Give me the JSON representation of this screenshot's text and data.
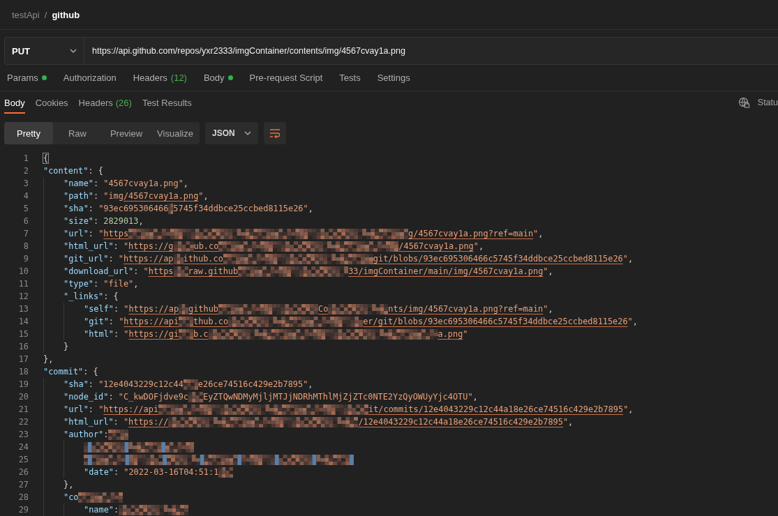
{
  "breadcrumb": {
    "parent": "testApi",
    "separator": "/",
    "current": "github"
  },
  "request": {
    "method": "PUT",
    "url": "https://api.github.com/repos/yxr2333/imgContainer/contents/img/4567cvay1a.png"
  },
  "request_tabs": [
    {
      "label": "Params",
      "indicator": true
    },
    {
      "label": "Authorization",
      "indicator": false
    },
    {
      "label": "Headers",
      "count": "(12)",
      "indicator": false
    },
    {
      "label": "Body",
      "indicator": true
    },
    {
      "label": "Pre-request Script",
      "indicator": false
    },
    {
      "label": "Tests",
      "indicator": false
    },
    {
      "label": "Settings",
      "indicator": false
    }
  ],
  "response_tabs": [
    {
      "label": "Body",
      "selected": true
    },
    {
      "label": "Cookies",
      "selected": false
    },
    {
      "label": "Headers",
      "count": "(26)",
      "selected": false
    },
    {
      "label": "Test Results",
      "selected": false
    }
  ],
  "response_status": "Statu",
  "view_modes": [
    {
      "label": "Pretty",
      "selected": true
    },
    {
      "label": "Raw",
      "selected": false
    },
    {
      "label": "Preview",
      "selected": false
    },
    {
      "label": "Visualize",
      "selected": false
    }
  ],
  "format": "JSON",
  "code_lines": [
    {
      "num": "1",
      "segments": [
        {
          "kind": "bracket_match",
          "text": "{"
        }
      ]
    },
    {
      "num": "2",
      "segments": [
        {
          "kind": "key",
          "text": "\"content\""
        },
        {
          "kind": "punct",
          "text": ": {"
        }
      ],
      "children": [
        {
          "num": "3",
          "segments": [
            {
              "kind": "key",
              "text": "\"name\""
            },
            {
              "kind": "punct",
              "text": ": "
            },
            {
              "kind": "string",
              "text": "\"4567cvay1a.png\""
            },
            {
              "kind": "punct",
              "text": ","
            }
          ]
        },
        {
          "num": "4",
          "segments": [
            {
              "kind": "key",
              "text": "\"path\""
            },
            {
              "kind": "punct",
              "text": ": "
            },
            {
              "kind": "string",
              "text": "\"img"
            },
            {
              "kind": "link",
              "text": "/4567cvay1a.png"
            },
            {
              "kind": "string",
              "text": "\""
            },
            {
              "kind": "punct",
              "text": ","
            }
          ]
        },
        {
          "num": "5",
          "segments": [
            {
              "kind": "key",
              "text": "\"sha\""
            },
            {
              "kind": "punct",
              "text": ": "
            },
            {
              "kind": "string",
              "text": "\"93ec695306466"
            },
            {
              "kind": "redacted"
            },
            {
              "kind": "string",
              "text": "5745f34ddbce25ccbed8115e26\""
            },
            {
              "kind": "punct",
              "text": ","
            }
          ]
        },
        {
          "num": "6",
          "segments": [
            {
              "kind": "key",
              "text": "\"size\""
            },
            {
              "kind": "punct",
              "text": ": "
            },
            {
              "kind": "number",
              "text": "2829013"
            },
            {
              "kind": "punct",
              "text": ","
            }
          ]
        },
        {
          "num": "7",
          "segments": [
            {
              "kind": "key",
              "text": "\"url\""
            },
            {
              "kind": "punct",
              "text": ": "
            },
            {
              "kind": "string",
              "text": "\""
            },
            {
              "kind": "link",
              "text": "https"
            },
            {
              "kind": "redacted"
            },
            {
              "kind": "link",
              "text": "g/4567cvay1a.png?ref=main"
            },
            {
              "kind": "string",
              "text": "\""
            },
            {
              "kind": "punct",
              "text": ","
            }
          ]
        },
        {
          "num": "8",
          "segments": [
            {
              "kind": "key",
              "text": "\"html_url\""
            },
            {
              "kind": "punct",
              "text": ": "
            },
            {
              "kind": "string",
              "text": "\""
            },
            {
              "kind": "link",
              "text": "https://g"
            },
            {
              "kind": "redacted"
            },
            {
              "kind": "link",
              "text": "ub.co"
            },
            {
              "kind": "redacted"
            },
            {
              "kind": "link",
              "text": "/4567cvay1a.png"
            },
            {
              "kind": "string",
              "text": "\""
            },
            {
              "kind": "punct",
              "text": ","
            }
          ]
        },
        {
          "num": "9",
          "segments": [
            {
              "kind": "key",
              "text": "\"git_url\""
            },
            {
              "kind": "punct",
              "text": ": "
            },
            {
              "kind": "string",
              "text": "\""
            },
            {
              "kind": "link",
              "text": "https://ap"
            },
            {
              "kind": "redacted"
            },
            {
              "kind": "link",
              "text": "ithub.co"
            },
            {
              "kind": "redacted"
            },
            {
              "kind": "link",
              "text": "git/blobs/93ec695306466c5745f34ddbce25ccbed8115e26"
            },
            {
              "kind": "string",
              "text": "\""
            },
            {
              "kind": "punct",
              "text": ","
            }
          ]
        },
        {
          "num": "10",
          "segments": [
            {
              "kind": "key",
              "text": "\"download_url\""
            },
            {
              "kind": "punct",
              "text": ": "
            },
            {
              "kind": "string",
              "text": "\""
            },
            {
              "kind": "link",
              "text": "https"
            },
            {
              "kind": "redacted"
            },
            {
              "kind": "link",
              "text": "raw.github"
            },
            {
              "kind": "redacted"
            },
            {
              "kind": "link",
              "text": "33/imgContainer/main/img/4567cvay1a.png"
            },
            {
              "kind": "string",
              "text": "\""
            },
            {
              "kind": "punct",
              "text": ","
            }
          ]
        },
        {
          "num": "11",
          "segments": [
            {
              "kind": "key",
              "text": "\"type\""
            },
            {
              "kind": "punct",
              "text": ": "
            },
            {
              "kind": "string",
              "text": "\"file\""
            },
            {
              "kind": "punct",
              "text": ","
            }
          ]
        },
        {
          "num": "12",
          "segments": [
            {
              "kind": "key",
              "text": "\"_links\""
            },
            {
              "kind": "punct",
              "text": ": {"
            }
          ],
          "children": [
            {
              "num": "13",
              "segments": [
                {
                  "kind": "key",
                  "text": "\"self\""
                },
                {
                  "kind": "punct",
                  "text": ": "
                },
                {
                  "kind": "string",
                  "text": "\""
                },
                {
                  "kind": "link",
                  "text": "https://ap"
                },
                {
                  "kind": "redacted"
                },
                {
                  "kind": "link",
                  "text": "github"
                },
                {
                  "kind": "redacted"
                },
                {
                  "kind": "link",
                  "text": "Co"
                },
                {
                  "kind": "redacted"
                },
                {
                  "kind": "link",
                  "text": "nts/img/4567cvay1a.png?ref=main"
                },
                {
                  "kind": "string",
                  "text": "\""
                },
                {
                  "kind": "punct",
                  "text": ","
                }
              ]
            },
            {
              "num": "14",
              "segments": [
                {
                  "kind": "key",
                  "text": "\"git\""
                },
                {
                  "kind": "punct",
                  "text": ": "
                },
                {
                  "kind": "string",
                  "text": "\""
                },
                {
                  "kind": "link",
                  "text": "https://api"
                },
                {
                  "kind": "redacted"
                },
                {
                  "kind": "link",
                  "text": "thub.co"
                },
                {
                  "kind": "redacted"
                },
                {
                  "kind": "link",
                  "text": "er/git/blobs/93ec695306466c5745f34ddbce25ccbed8115e26"
                },
                {
                  "kind": "string",
                  "text": "\""
                },
                {
                  "kind": "punct",
                  "text": ","
                }
              ]
            },
            {
              "num": "15",
              "segments": [
                {
                  "kind": "key",
                  "text": "\"html\""
                },
                {
                  "kind": "punct",
                  "text": ": "
                },
                {
                  "kind": "string",
                  "text": "\""
                },
                {
                  "kind": "link",
                  "text": "https://gi"
                },
                {
                  "kind": "redacted"
                },
                {
                  "kind": "link",
                  "text": "b.c"
                },
                {
                  "kind": "redacted"
                },
                {
                  "kind": "link",
                  "text": "a.png"
                },
                {
                  "kind": "string",
                  "text": "\""
                }
              ]
            }
          ]
        },
        {
          "num": "16",
          "segments": [
            {
              "kind": "punct",
              "text": "}"
            }
          ]
        }
      ]
    },
    {
      "num": "17",
      "segments": [
        {
          "kind": "punct",
          "text": "},"
        }
      ]
    },
    {
      "num": "18",
      "segments": [
        {
          "kind": "key",
          "text": "\"commit\""
        },
        {
          "kind": "punct",
          "text": ": {"
        }
      ],
      "children": [
        {
          "num": "19",
          "segments": [
            {
              "kind": "key",
              "text": "\"sha\""
            },
            {
              "kind": "punct",
              "text": ": "
            },
            {
              "kind": "string",
              "text": "\"12e4043229c12c44"
            },
            {
              "kind": "redacted"
            },
            {
              "kind": "string",
              "text": "e26ce74516c429e2b7895\""
            },
            {
              "kind": "punct",
              "text": ","
            }
          ]
        },
        {
          "num": "20",
          "segments": [
            {
              "kind": "key",
              "text": "\"node_id\""
            },
            {
              "kind": "punct",
              "text": ": "
            },
            {
              "kind": "string",
              "text": "\"C_kwDOFjdve9c"
            },
            {
              "kind": "redacted"
            },
            {
              "kind": "string",
              "text": "EyZTQwNDMyMjljMTJjNDRhMThlMjZjZTc0NTE2YzQyOWUyYjc4OTU\""
            },
            {
              "kind": "punct",
              "text": ","
            }
          ]
        },
        {
          "num": "21",
          "segments": [
            {
              "kind": "key",
              "text": "\"url\""
            },
            {
              "kind": "punct",
              "text": ": "
            },
            {
              "kind": "string",
              "text": "\""
            },
            {
              "kind": "link",
              "text": "https://api"
            },
            {
              "kind": "redacted"
            },
            {
              "kind": "link",
              "text": "it/commits/12e4043229c12c44a18e26ce74516c429e2b7895"
            },
            {
              "kind": "string",
              "text": "\""
            },
            {
              "kind": "punct",
              "text": ","
            }
          ]
        },
        {
          "num": "22",
          "segments": [
            {
              "kind": "key",
              "text": "\"html_url\""
            },
            {
              "kind": "punct",
              "text": ": "
            },
            {
              "kind": "string",
              "text": "\""
            },
            {
              "kind": "link",
              "text": "https://"
            },
            {
              "kind": "redacted"
            },
            {
              "kind": "link",
              "text": "/12e4043229c12c44a18e26ce74516c429e2b7895"
            },
            {
              "kind": "string",
              "text": "\""
            },
            {
              "kind": "punct",
              "text": ","
            }
          ]
        },
        {
          "num": "23",
          "segments": [
            {
              "kind": "key",
              "text": "\"author\""
            },
            {
              "kind": "punct",
              "text": ":"
            },
            {
              "kind": "redacted"
            }
          ],
          "children": [
            {
              "num": "24",
              "segments": [
                {
                  "kind": "redacted"
                }
              ]
            },
            {
              "num": "25",
              "segments": [
                {
                  "kind": "redacted"
                }
              ]
            },
            {
              "num": "26",
              "segments": [
                {
                  "kind": "key",
                  "text": "\"date\""
                },
                {
                  "kind": "punct",
                  "text": ": "
                },
                {
                  "kind": "string",
                  "text": "\"2022-03-16T04:51:1"
                },
                {
                  "kind": "redacted"
                }
              ]
            }
          ]
        },
        {
          "num": "27",
          "segments": [
            {
              "kind": "punct",
              "text": "},"
            }
          ]
        },
        {
          "num": "28",
          "segments": [
            {
              "kind": "key",
              "text": "\"co"
            },
            {
              "kind": "redacted"
            }
          ],
          "children": [
            {
              "num": "29",
              "segments": [
                {
                  "kind": "key",
                  "text": "\"name\""
                },
                {
                  "kind": "punct",
                  "text": ": "
                },
                {
                  "kind": "redacted"
                }
              ]
            }
          ]
        }
      ]
    }
  ]
}
